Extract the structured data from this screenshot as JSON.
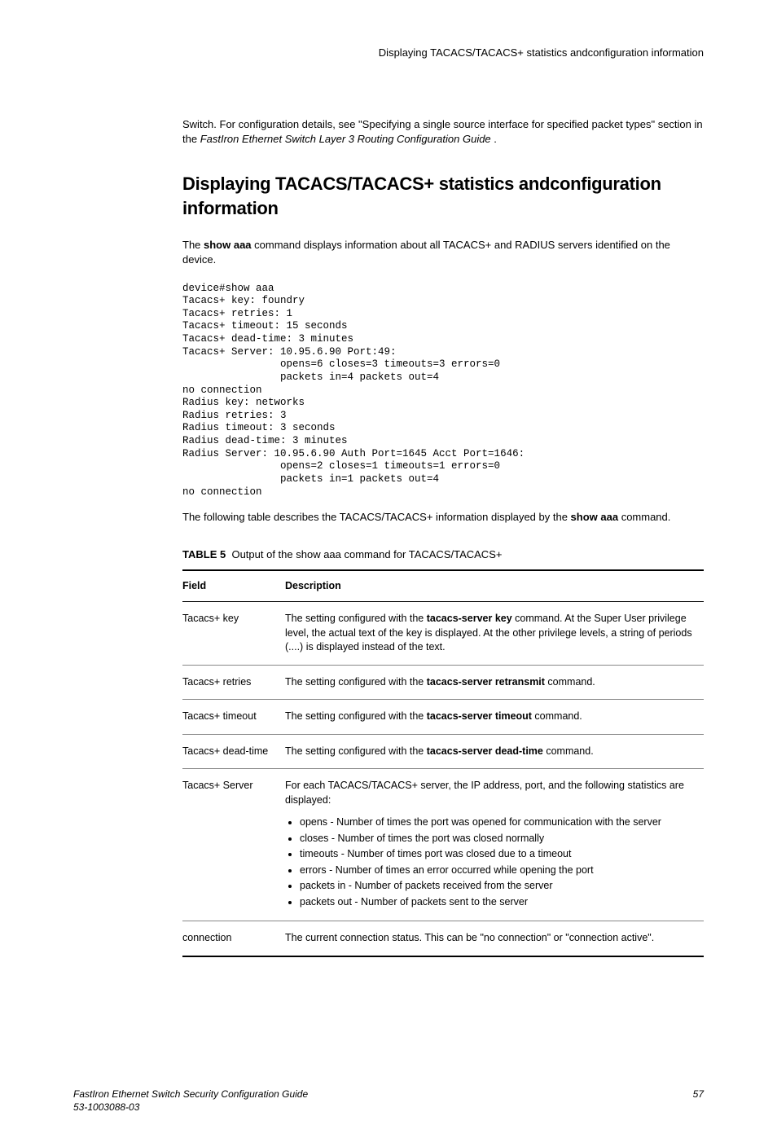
{
  "header": {
    "running_head": "Displaying TACACS/TACACS+ statistics andconfiguration information"
  },
  "intro": {
    "text_before": "Switch. For configuration details, see \"Specifying a single source interface for specified packet types\" section in the ",
    "emph": "FastIron Ethernet Switch Layer 3 Routing Configuration Guide",
    "text_after": " ."
  },
  "heading": "Displaying TACACS/TACACS+ statistics andconfiguration information",
  "lead": {
    "pre": "The ",
    "cmd": "show aaa",
    "post": " command displays information about all TACACS+ and RADIUS servers identified on the device."
  },
  "code": "device#show aaa\nTacacs+ key: foundry\nTacacs+ retries: 1\nTacacs+ timeout: 15 seconds\nTacacs+ dead-time: 3 minutes\nTacacs+ Server: 10.95.6.90 Port:49:\n                opens=6 closes=3 timeouts=3 errors=0\n                packets in=4 packets out=4\nno connection\nRadius key: networks\nRadius retries: 3\nRadius timeout: 3 seconds\nRadius dead-time: 3 minutes\nRadius Server: 10.95.6.90 Auth Port=1645 Acct Port=1646:\n                opens=2 closes=1 timeouts=1 errors=0\n                packets in=1 packets out=4\nno connection",
  "after_code": {
    "pre": "The following table describes the TACACS/TACACS+ information displayed by the ",
    "cmd": "show aaa",
    "post": " command."
  },
  "table_caption": {
    "label": "TABLE 5",
    "title": "Output of the show aaa command for TACACS/TACACS+"
  },
  "table": {
    "headers": {
      "field": "Field",
      "desc": "Description"
    },
    "rows": [
      {
        "field": "Tacacs+ key",
        "pre": "The setting configured with the ",
        "bold": "tacacs-server key",
        "post": " command. At the Super User privilege level, the actual text of the key is displayed. At the other privilege levels, a string of periods (....) is displayed instead of the text."
      },
      {
        "field": "Tacacs+ retries",
        "pre": "The setting configured with the ",
        "bold": "tacacs-server retransmit",
        "post": " command."
      },
      {
        "field": "Tacacs+ timeout",
        "pre": "The setting configured with the ",
        "bold": "tacacs-server timeout",
        "post": " command."
      },
      {
        "field": "Tacacs+ dead-time",
        "pre": "The setting configured with the ",
        "bold": "tacacs-server dead-time",
        "post": " command."
      },
      {
        "field": "Tacacs+ Server",
        "intro": "For each TACACS/TACACS+ server, the IP address, port, and the following statistics are displayed:",
        "bullets": [
          "opens - Number of times the port was opened for communication with the server",
          "closes - Number of times the port was closed normally",
          "timeouts - Number of times port was closed due to a timeout",
          "errors - Number of times an error occurred while opening the port",
          "packets in - Number of packets received from the server",
          "packets out - Number of packets sent to the server"
        ]
      },
      {
        "field": "connection",
        "plain": "The current connection status. This can be \"no connection\" or \"connection active\"."
      }
    ]
  },
  "footer": {
    "doc_title": "FastIron Ethernet Switch Security Configuration Guide",
    "doc_num": "53-1003088-03",
    "page": "57"
  }
}
